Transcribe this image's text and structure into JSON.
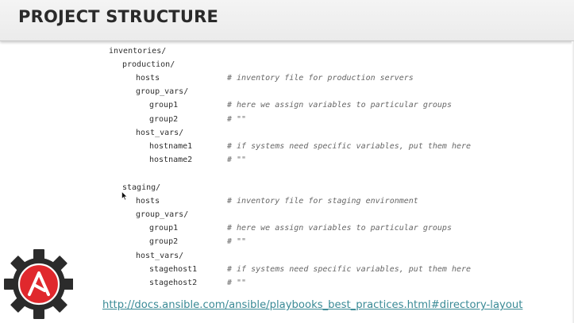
{
  "slide": {
    "title": "PROJECT STRUCTURE",
    "link": "http://docs.ansible.com/ansible/playbooks_best_practices.html#directory-layout"
  },
  "tree": {
    "root": "inventories/",
    "production": {
      "dir": "production/",
      "hosts": "hosts",
      "hosts_comment": "# inventory file for production servers",
      "group_vars": "group_vars/",
      "group1": "group1",
      "group1_comment": "# here we assign variables to particular groups",
      "group2": "group2",
      "group2_comment": "# \"\"",
      "host_vars": "host_vars/",
      "host1": "hostname1",
      "host1_comment": "# if systems need specific variables, put them here",
      "host2": "hostname2",
      "host2_comment": "# \"\""
    },
    "staging": {
      "dir": "staging/",
      "hosts": "hosts",
      "hosts_comment": "# inventory file for staging environment",
      "group_vars": "group_vars/",
      "group1": "group1",
      "group1_comment": "# here we assign variables to particular groups",
      "group2": "group2",
      "group2_comment": "# \"\"",
      "host_vars": "host_vars/",
      "host1": "stagehost1",
      "host1_comment": "# if systems need specific variables, put them here",
      "host2": "stagehost2",
      "host2_comment": "# \"\""
    }
  },
  "colors": {
    "logo_red": "#e0282d",
    "logo_gear": "#2b2b2b",
    "link": "#3a8a96"
  },
  "icons": {
    "logo": "ansible-logo-icon",
    "cursor": "mouse-pointer-icon"
  }
}
